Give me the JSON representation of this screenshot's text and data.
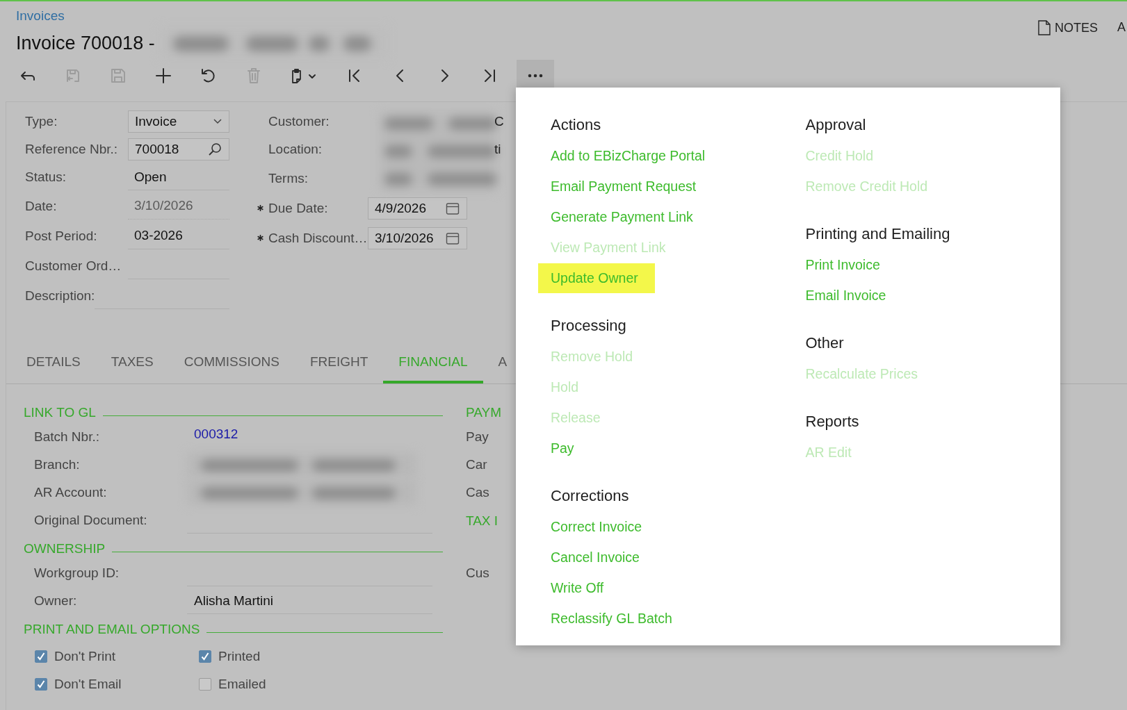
{
  "breadcrumb": "Invoices",
  "title": "Invoice 700018 -",
  "notes_button": "NOTES",
  "cut_button": "A",
  "toolbar": [
    {
      "kind": "back",
      "disabled": false,
      "expanded": false
    },
    {
      "kind": "save-close",
      "disabled": true,
      "expanded": false
    },
    {
      "kind": "save",
      "disabled": true,
      "expanded": false
    },
    {
      "kind": "add",
      "disabled": false,
      "expanded": false
    },
    {
      "kind": "undo",
      "disabled": false,
      "expanded": false
    },
    {
      "kind": "delete",
      "disabled": true,
      "expanded": false
    },
    {
      "kind": "paste",
      "disabled": false,
      "expanded": false
    },
    {
      "kind": "first",
      "disabled": false,
      "expanded": false
    },
    {
      "kind": "previous",
      "disabled": false,
      "expanded": false
    },
    {
      "kind": "next",
      "disabled": false,
      "expanded": false
    },
    {
      "kind": "last",
      "disabled": false,
      "expanded": false
    },
    {
      "kind": "more",
      "disabled": false,
      "expanded": true
    }
  ],
  "form": {
    "left": [
      {
        "label": "Type:",
        "kind": "select",
        "value": "Invoice",
        "disabled": false
      },
      {
        "label": "Reference Nbr.:",
        "kind": "lookup",
        "value": "700018",
        "disabled": false
      },
      {
        "label": "Status:",
        "kind": "text",
        "value": "Open",
        "disabled": false
      },
      {
        "label": "Date:",
        "kind": "text",
        "value": "3/10/2026",
        "disabled": true
      },
      {
        "label": "Post Period:",
        "kind": "text",
        "value": "03-2026",
        "disabled": false
      },
      {
        "label": "Customer Ord…",
        "kind": "text",
        "disabled": false
      },
      {
        "label": "Description:",
        "kind": "text",
        "disabled": false
      }
    ],
    "right": [
      {
        "label": "Customer:",
        "required": false,
        "cut": "C"
      },
      {
        "label": "Location:",
        "required": false,
        "cut": "ti"
      },
      {
        "label": "Terms:",
        "required": false
      },
      {
        "label": "Due Date:",
        "required": true,
        "value": "4/9/2026"
      },
      {
        "label": "Cash Discount…",
        "required": true,
        "value": "3/10/2026"
      }
    ]
  },
  "tabs": [
    {
      "label": "DETAILS",
      "selected": false
    },
    {
      "label": "TAXES",
      "selected": false
    },
    {
      "label": "COMMISSIONS",
      "selected": false
    },
    {
      "label": "FREIGHT",
      "selected": false
    },
    {
      "label": "FINANCIAL",
      "selected": true
    },
    {
      "label": "A",
      "selected": false
    }
  ],
  "financial": {
    "sections": [
      {
        "title": "LINK TO GL",
        "fields": [
          {
            "label": "Batch Nbr.:",
            "kind": "link",
            "value": "000312"
          },
          {
            "label": "Branch:",
            "kind": "redacted"
          },
          {
            "label": "AR Account:",
            "kind": "redacted"
          },
          {
            "label": "Original Document:",
            "kind": "text"
          }
        ]
      },
      {
        "title": "OWNERSHIP",
        "fields": [
          {
            "label": "Workgroup ID:",
            "kind": "text"
          },
          {
            "label": "Owner:",
            "kind": "text",
            "value": "Alisha Martini"
          }
        ]
      },
      {
        "title": "PRINT AND EMAIL OPTIONS",
        "checkboxes": [
          {
            "label": "Don't Print",
            "checked": true
          },
          {
            "label": "Printed",
            "checked": true
          },
          {
            "label": "Don't Email",
            "checked": true
          },
          {
            "label": "Emailed",
            "checked": false
          }
        ]
      }
    ],
    "right_fragments": [
      {
        "kind": "heading",
        "text": "PAYM"
      },
      {
        "kind": "label",
        "text": "Pay"
      },
      {
        "kind": "label",
        "text": "Car"
      },
      {
        "kind": "label",
        "text": "Cas"
      },
      {
        "kind": "heading",
        "text": "TAX I"
      },
      {
        "kind": "label",
        "text": "Cus"
      }
    ]
  },
  "menu": {
    "columns": [
      {
        "sections": [
          {
            "title": "Actions",
            "items": [
              {
                "label": "Add to EBizCharge Portal",
                "disabled": false,
                "selected": false
              },
              {
                "label": "Email Payment Request",
                "disabled": false,
                "selected": false
              },
              {
                "label": "Generate Payment Link",
                "disabled": false,
                "selected": false
              },
              {
                "label": "View Payment Link",
                "disabled": true,
                "selected": false
              },
              {
                "label": "Update Owner",
                "disabled": false,
                "selected": true
              }
            ]
          },
          {
            "title": "Processing",
            "items": [
              {
                "label": "Remove Hold",
                "disabled": true,
                "selected": false
              },
              {
                "label": "Hold",
                "disabled": true,
                "selected": false
              },
              {
                "label": "Release",
                "disabled": true,
                "selected": false
              },
              {
                "label": "Pay",
                "disabled": false,
                "selected": false
              }
            ]
          },
          {
            "title": "Corrections",
            "items": [
              {
                "label": "Correct Invoice",
                "disabled": false,
                "selected": false
              },
              {
                "label": "Cancel Invoice",
                "disabled": false,
                "selected": false
              },
              {
                "label": "Write Off",
                "disabled": false,
                "selected": false
              },
              {
                "label": "Reclassify GL Batch",
                "disabled": false,
                "selected": false
              }
            ]
          }
        ]
      },
      {
        "sections": [
          {
            "title": "Approval",
            "items": [
              {
                "label": "Credit Hold",
                "disabled": true,
                "selected": false
              },
              {
                "label": "Remove Credit Hold",
                "disabled": true,
                "selected": false
              }
            ]
          },
          {
            "title": "Printing and Emailing",
            "items": [
              {
                "label": "Print Invoice",
                "disabled": false,
                "selected": false
              },
              {
                "label": "Email Invoice",
                "disabled": false,
                "selected": false
              }
            ]
          },
          {
            "title": "Other",
            "items": [
              {
                "label": "Recalculate Prices",
                "disabled": true,
                "selected": false
              }
            ]
          },
          {
            "title": "Reports",
            "items": [
              {
                "label": "AR Edit",
                "disabled": true,
                "selected": false
              }
            ]
          }
        ]
      }
    ]
  }
}
